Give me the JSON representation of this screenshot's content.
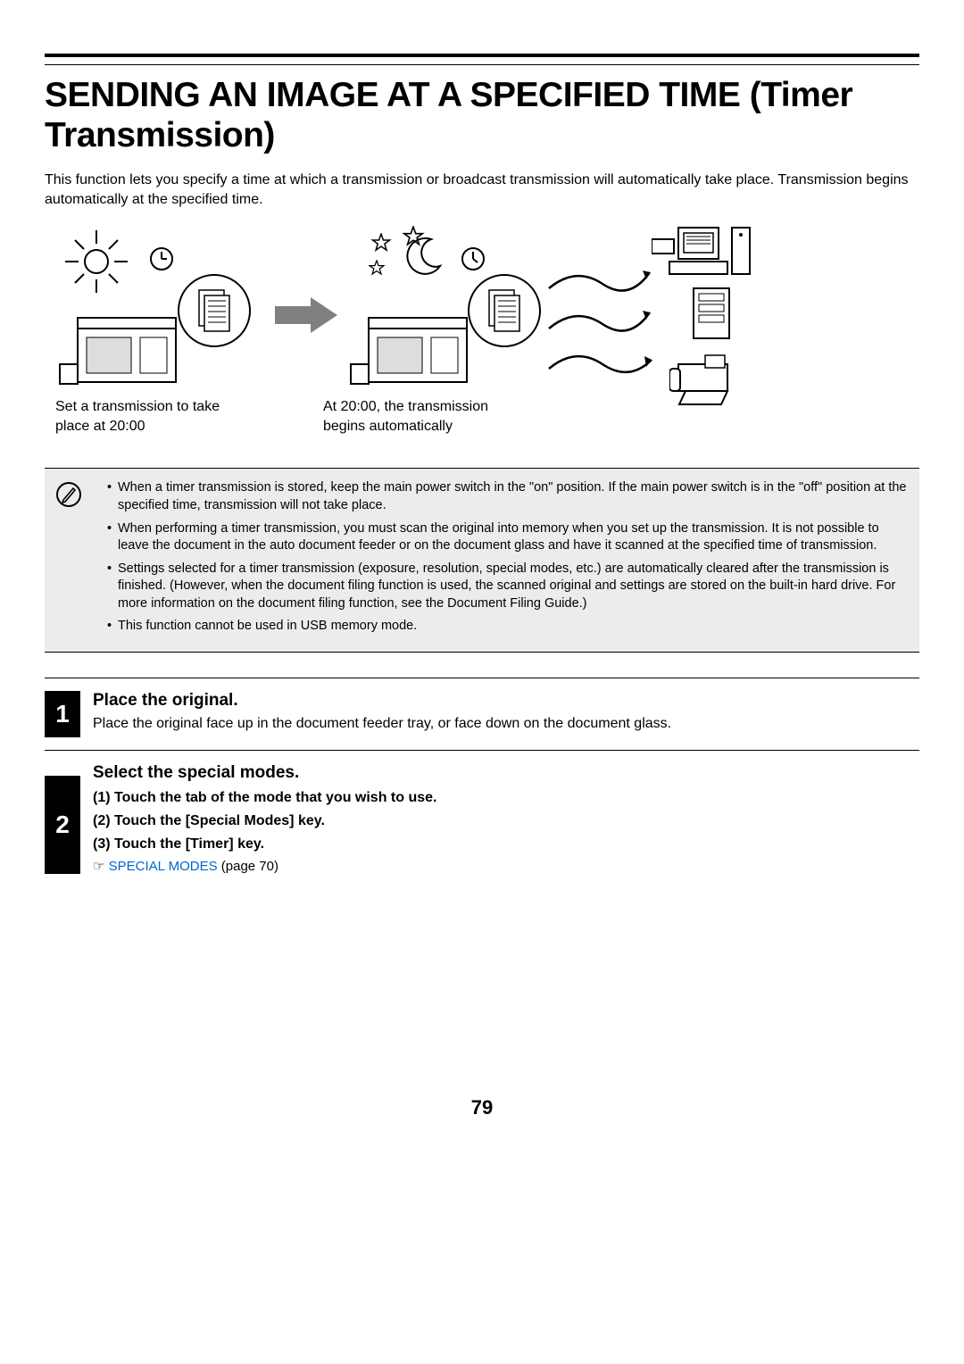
{
  "heading": "SENDING AN IMAGE AT A SPECIFIED TIME (Timer Transmission)",
  "intro": "This function lets you specify a time at which a transmission or broadcast transmission will automatically take place. Transmission begins automatically at the specified time.",
  "diagram": {
    "caption1": "Set a transmission to take place at 20:00",
    "caption2": "At 20:00, the transmission begins automatically"
  },
  "info": {
    "bullets": [
      "When a timer transmission is stored, keep the main power switch in the \"on\" position. If the main power switch is in the \"off\" position at the specified time, transmission will not take place.",
      "When performing a timer transmission, you must scan the original into memory when you set up the transmission. It is not possible to leave the document in the auto document feeder or on the document glass and have it scanned at the specified time of transmission.",
      "Settings selected for a timer transmission (exposure, resolution, special modes, etc.) are automatically cleared after the transmission is finished. (However, when the document filing function is used, the scanned original and settings are stored on the built-in hard drive. For more information on the document filing function, see the Document Filing Guide.)",
      "This function cannot be used in USB memory mode."
    ]
  },
  "step1": {
    "num": "1",
    "title": "Place the original.",
    "desc": "Place the original face up in the document feeder tray, or face down on the document glass."
  },
  "step2": {
    "num": "2",
    "title": "Select the special modes.",
    "sub1": "(1)  Touch the tab of the mode that you wish to use.",
    "sub2": "(2)  Touch the [Special Modes] key.",
    "sub3": "(3)  Touch the [Timer] key.",
    "link_prefix": "☞ ",
    "link_text": "SPECIAL MODES",
    "link_suffix": " (page 70)"
  },
  "page_number": "79"
}
